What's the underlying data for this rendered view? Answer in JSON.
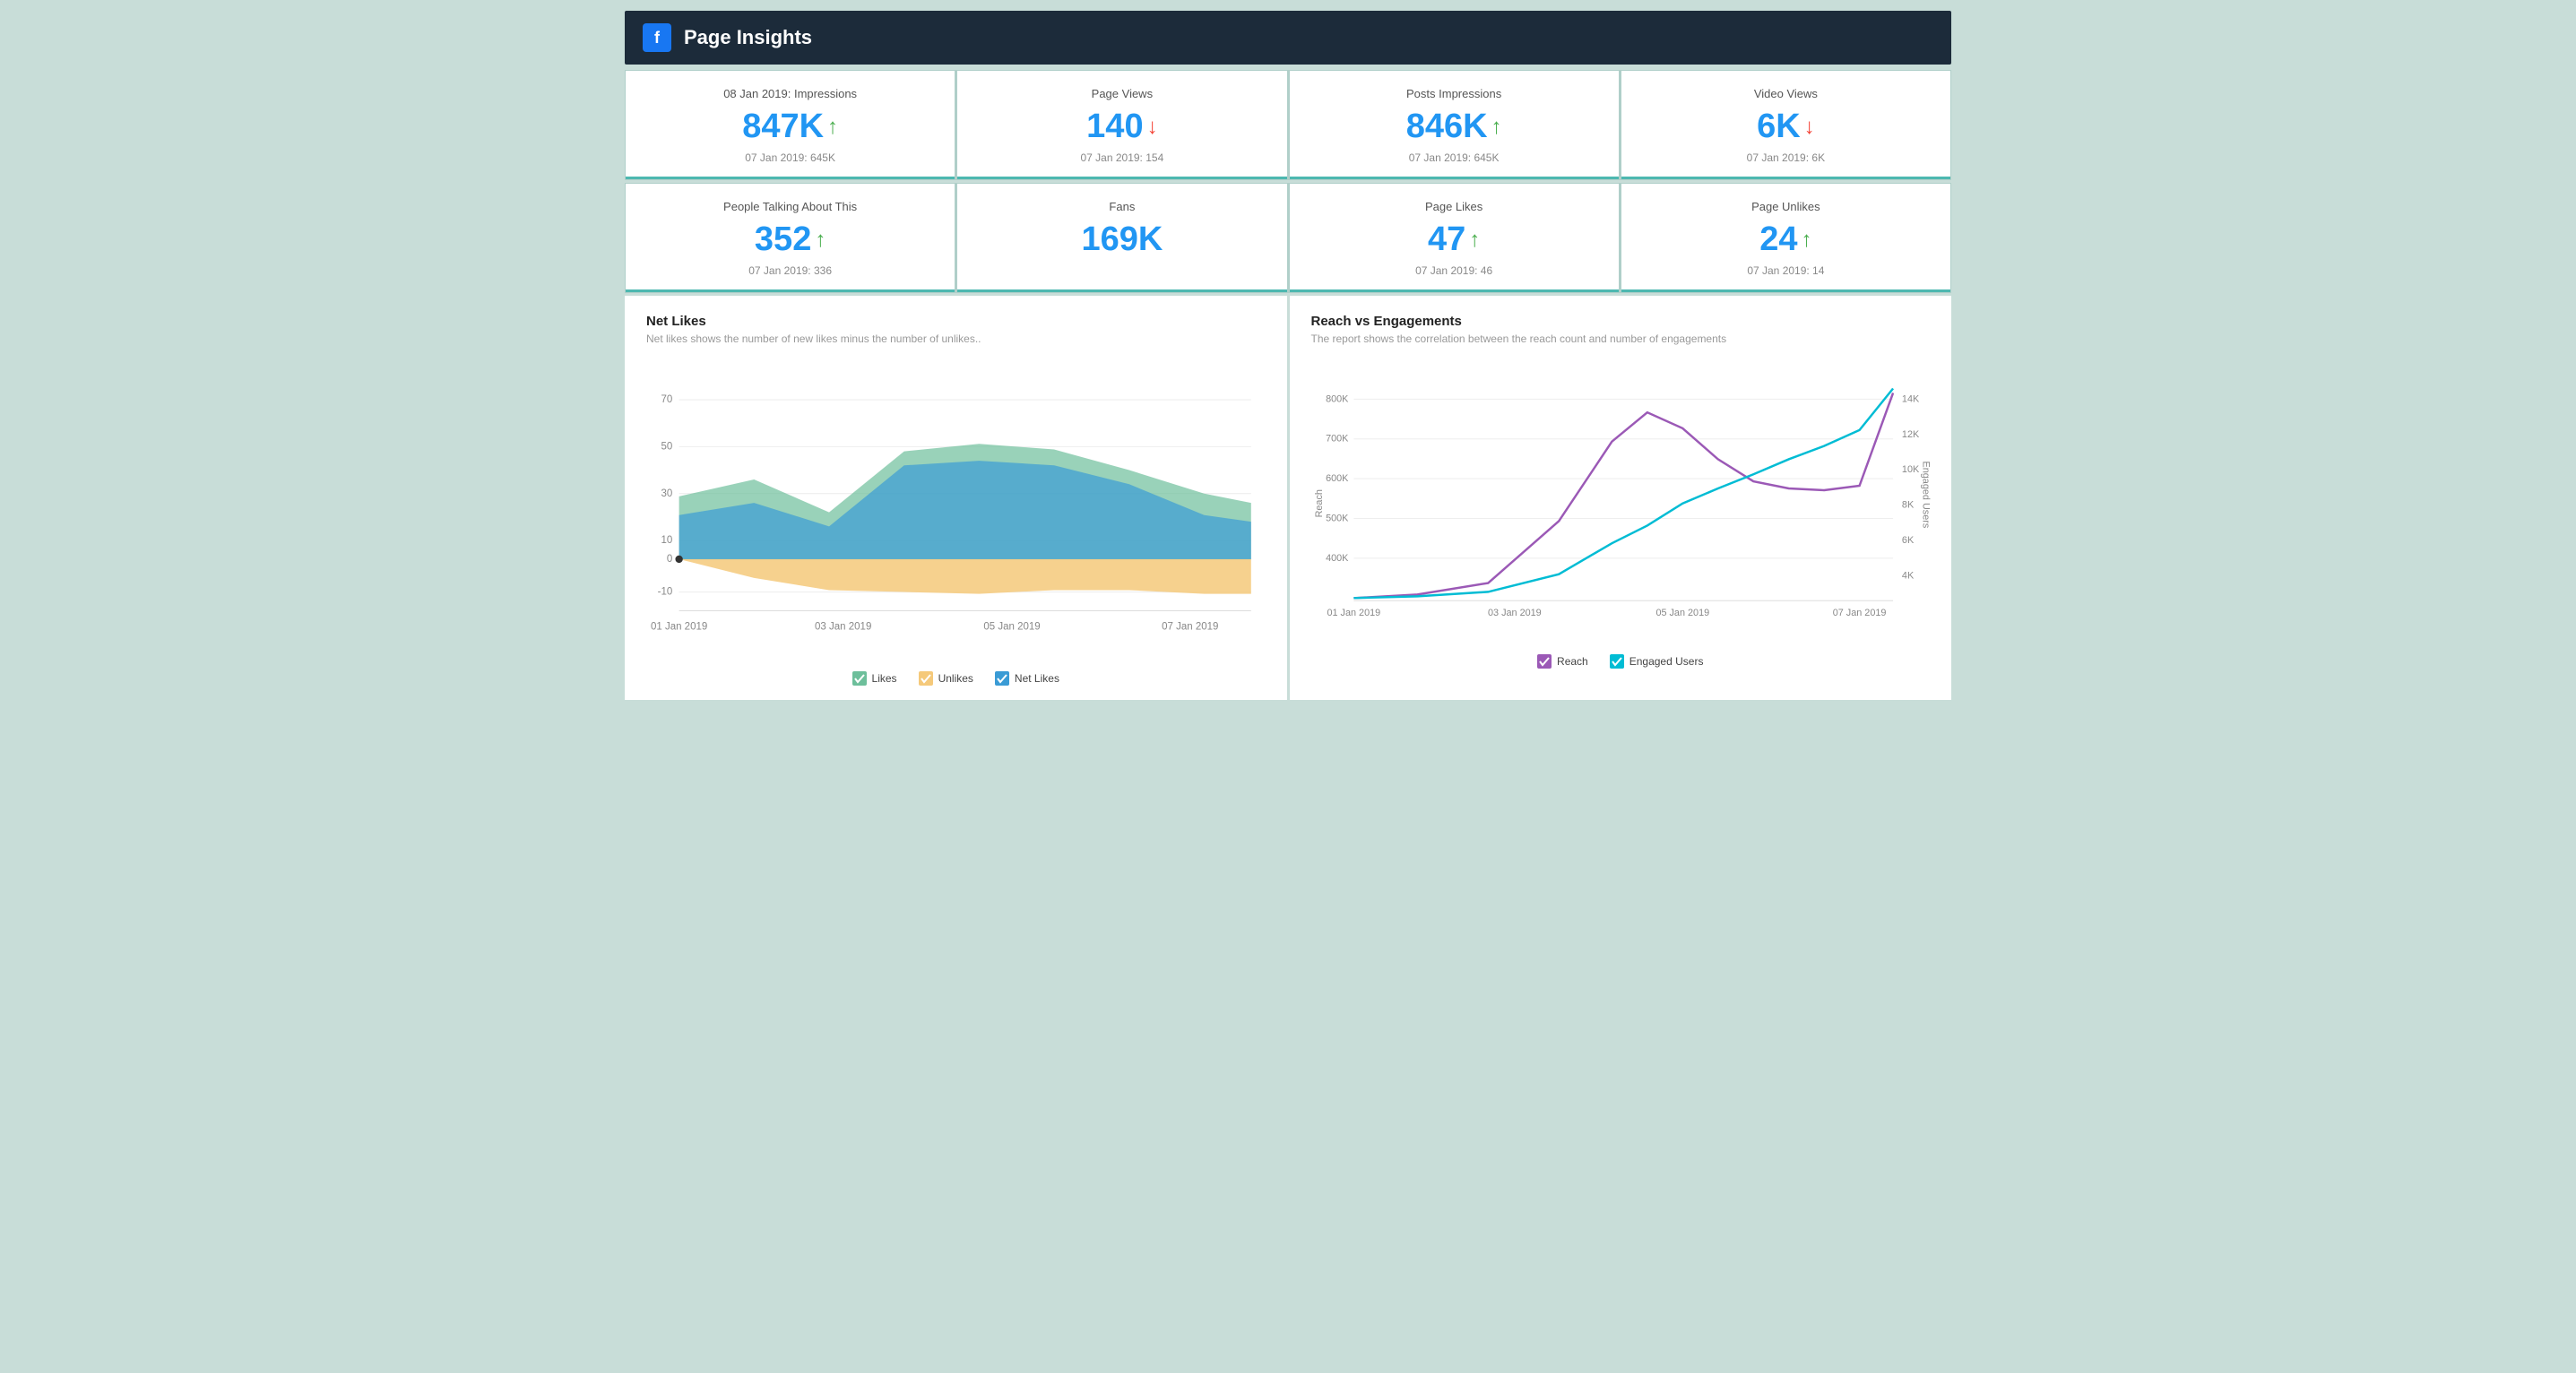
{
  "header": {
    "title": "Page Insights",
    "fb_icon": "f"
  },
  "colors": {
    "accent": "#4db8b0",
    "blue": "#2196f3",
    "green": "#4caf50",
    "red": "#f44336",
    "likes_fill": "#6dbf9b",
    "unlikes_fill": "#f5c97a",
    "netlikes_fill": "#3a9bd5",
    "reach_line": "#9b59b6",
    "engaged_line": "#00bcd4"
  },
  "metrics_row1": [
    {
      "label": "08 Jan 2019: Impressions",
      "value": "847K",
      "direction": "up",
      "prev": "07 Jan 2019: 645K"
    },
    {
      "label": "Page Views",
      "value": "140",
      "direction": "down",
      "prev": "07 Jan 2019: 154"
    },
    {
      "label": "Posts Impressions",
      "value": "846K",
      "direction": "up",
      "prev": "07 Jan 2019: 645K"
    },
    {
      "label": "Video Views",
      "value": "6K",
      "direction": "down",
      "prev": "07 Jan 2019: 6K"
    }
  ],
  "metrics_row2": [
    {
      "label": "People Talking About This",
      "value": "352",
      "direction": "up",
      "prev": "07 Jan 2019: 336"
    },
    {
      "label": "Fans",
      "value": "169K",
      "direction": "none",
      "prev": ""
    },
    {
      "label": "Page Likes",
      "value": "47",
      "direction": "up",
      "prev": "07 Jan 2019: 46"
    },
    {
      "label": "Page Unlikes",
      "value": "24",
      "direction": "up",
      "prev": "07 Jan 2019: 14"
    }
  ],
  "net_likes_chart": {
    "title": "Net Likes",
    "subtitle": "Net likes shows the number of new likes minus the number of unlikes..",
    "x_labels": [
      "01 Jan 2019",
      "03 Jan 2019",
      "05 Jan 2019",
      "07 Jan 2019"
    ],
    "y_labels": [
      "70",
      "50",
      "30",
      "10",
      "0",
      "-10"
    ],
    "legend": [
      {
        "label": "Likes",
        "color": "#6dbf9b",
        "checked": true
      },
      {
        "label": "Unlikes",
        "color": "#f5c97a",
        "checked": true
      },
      {
        "label": "Net Likes",
        "color": "#3a9bd5",
        "checked": true
      }
    ]
  },
  "reach_chart": {
    "title": "Reach vs Engagements",
    "subtitle": "The report shows the correlation between the reach count and number of engagements",
    "x_labels": [
      "01 Jan 2019",
      "03 Jan 2019",
      "05 Jan 2019",
      "07 Jan 2019"
    ],
    "y_left_labels": [
      "800K",
      "700K",
      "600K",
      "500K",
      "400K"
    ],
    "y_right_labels": [
      "14K",
      "12K",
      "10K",
      "8K",
      "6K",
      "4K"
    ],
    "left_axis_label": "Reach",
    "right_axis_label": "Engaged Users",
    "legend": [
      {
        "label": "Reach",
        "color": "#9b59b6",
        "checked": true
      },
      {
        "label": "Engaged Users",
        "color": "#00bcd4",
        "checked": true
      }
    ]
  }
}
